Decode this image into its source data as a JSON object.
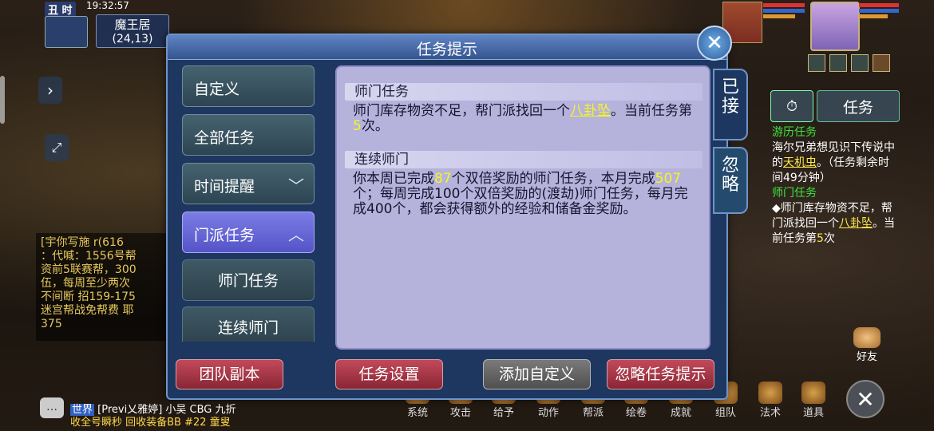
{
  "status": {
    "time_label": "丑 时",
    "clock": "19:32:57",
    "location": "魔王居",
    "coords": "(24,13)"
  },
  "chat_log": {
    "lines": [
      "[宇你写施 r(616",
      "：代喊：1556号帮",
      "资前5联赛帮，300",
      "伍，每周至少两次",
      "不间断 招159-175",
      "迷宫帮战免帮费 耶",
      "375"
    ]
  },
  "world_chat": {
    "channel": "世界",
    "line1": "[Previ乂雅婷] 小吴 CBG 九折",
    "line2": "收全号瞬秒 回收装备BB #22 童叟"
  },
  "bottom_menu": {
    "items": [
      "系统",
      "攻击",
      "给予",
      "动作",
      "帮派",
      "绘卷",
      "成就",
      "组队",
      "法术",
      "道具"
    ]
  },
  "friend_label": "好友",
  "task_tabs": {
    "timer_icon": "clock-icon",
    "task_label": "任务"
  },
  "tracker": {
    "t1_title": "游历任务",
    "t1_a": "海尔兄弟想见识下传说中的",
    "t1_link": "天机虫",
    "t1_b": "。（任务剩余时间49分钟）",
    "t2_title": "师门任务",
    "t2_a": "◆师门库存物资不足，帮门派找回一个",
    "t2_link": "八卦坠",
    "t2_b": "。当前任务第",
    "t2_num": "5",
    "t2_c": "次"
  },
  "dialog": {
    "title": "任务提示",
    "menu": [
      {
        "label": "自定义"
      },
      {
        "label": "全部任务"
      },
      {
        "label": "时间提醒"
      },
      {
        "label": "门派任务"
      }
    ],
    "submenu": [
      "师门任务",
      "连续师门"
    ],
    "side_tabs": [
      "已接",
      "忽略"
    ],
    "sections": {
      "s1_title": "师门任务",
      "s1_a": "师门库存物资不足，帮门派找回一个",
      "s1_link": "八卦坠",
      "s1_b": "。当前任务第",
      "s1_num": "5",
      "s1_c": "次。",
      "s2_title": "连续师门",
      "s2_a": "你本周已完成",
      "s2_n1": "87",
      "s2_b": "个双倍奖励的师门任务，本月完成",
      "s2_n2": "507",
      "s2_c": "个；每周完成100个双倍奖励的(渡劫)师门任务，每月完成400个，都会获得额外的经验和储备金奖励。"
    },
    "buttons": [
      "团队副本",
      "任务设置",
      "添加自定义",
      "忽略任务提示"
    ]
  },
  "colors": {
    "dialog_bg": "#1e3760",
    "content_bg": "#b5b2dc",
    "active_tab": "#6a6ad8",
    "red_button": "#a8323f",
    "highlight": "#f5f521",
    "tracker_green": "#3ee63e"
  }
}
